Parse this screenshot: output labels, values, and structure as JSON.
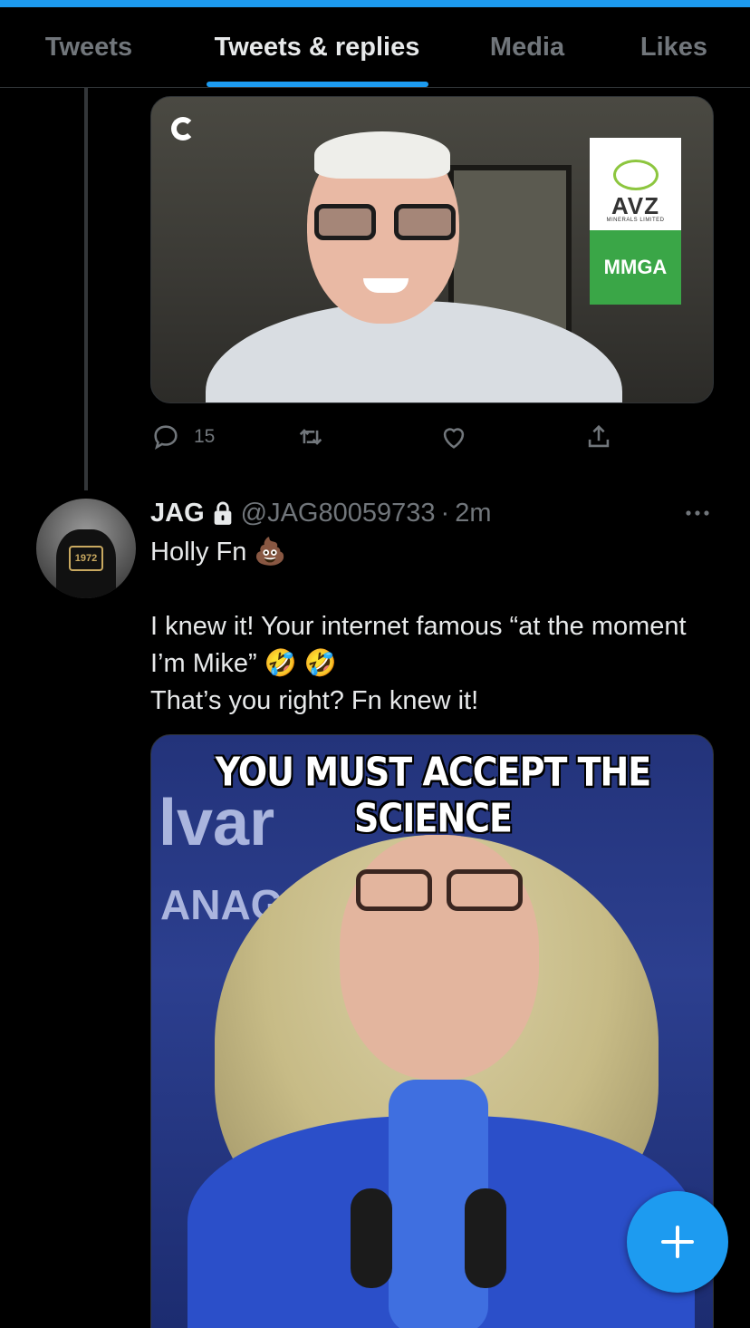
{
  "tabs": [
    {
      "label": "Tweets",
      "active": false
    },
    {
      "label": "Tweets & replies",
      "active": true
    },
    {
      "label": "Media",
      "active": false
    },
    {
      "label": "Likes",
      "active": false
    }
  ],
  "accent_color": "#1d9bf0",
  "previous_tweet": {
    "media": {
      "logo_name": "AVZ",
      "logo_subtext": "MINERALS LIMITED",
      "logo_banner": "MMGA"
    },
    "actions": {
      "reply_count": "15",
      "retweet_count": "",
      "like_count": ""
    }
  },
  "tweet": {
    "display_name": "JAG",
    "handle": "@JAG80059733",
    "separator": "·",
    "time": "2m",
    "avatar_badge_text": "1972",
    "lines": [
      "Holly Fn 💩",
      "",
      "I knew it! Your internet famous “at the moment I’m Mike” 🤣 🤣",
      "That’s you right? Fn knew it!"
    ],
    "media": {
      "caption": "YOU MUST ACCEPT THE SCIENCE",
      "background_text_1": "lvar",
      "background_text_2": "ANAGE"
    }
  },
  "icons": {
    "reply": "reply-icon",
    "retweet": "retweet-icon",
    "like": "heart-icon",
    "share": "share-icon",
    "lock": "lock-icon",
    "more": "more-icon",
    "compose": "plus-icon"
  }
}
